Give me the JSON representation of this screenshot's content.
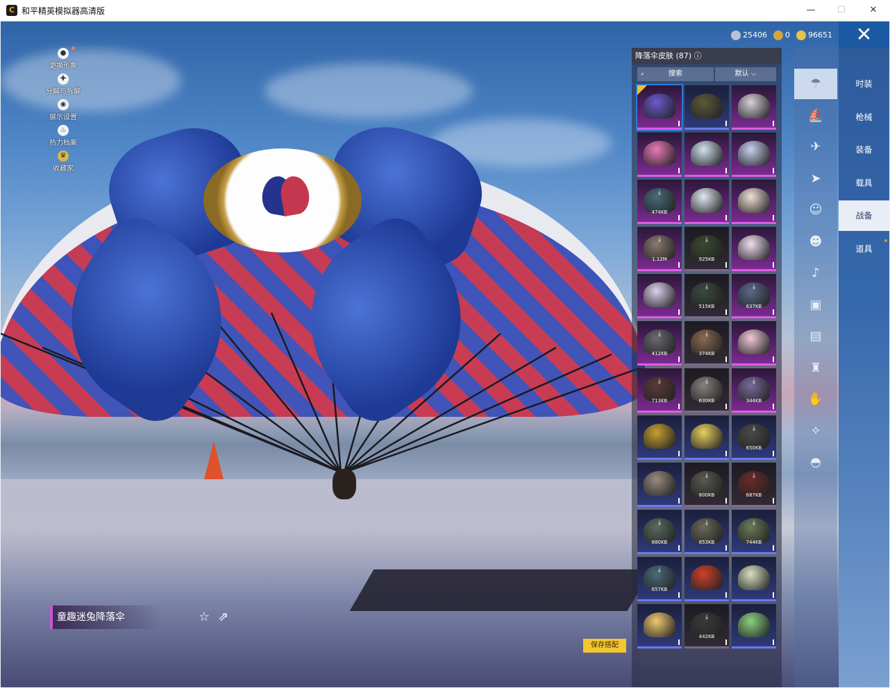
{
  "window": {
    "title": "和平精英模拟器高清版",
    "app_icon_glyph": "C",
    "controls": {
      "minimize": "—",
      "maximize": "☐",
      "close": "✕"
    }
  },
  "left_menu": [
    {
      "label": "更换形象",
      "icon": "person-icon",
      "glyph": "●"
    },
    {
      "label": "分解与拆解",
      "icon": "puzzle-icon",
      "glyph": "✚"
    },
    {
      "label": "展示设置",
      "icon": "eye-icon",
      "glyph": "◉"
    },
    {
      "label": "热力档案",
      "icon": "flame-icon",
      "glyph": "♨"
    },
    {
      "label": "收藏家",
      "icon": "crown-badge-icon",
      "glyph": "♛"
    }
  ],
  "currency": [
    {
      "value": "25406",
      "icon": "silver-coin-icon",
      "color": "#b9c3d3"
    },
    {
      "value": "0",
      "icon": "uc-token-icon",
      "color": "#d1a640"
    },
    {
      "value": "96651",
      "icon": "gold-coin-icon",
      "color": "#e9c34a"
    }
  ],
  "close_game_label": "✕",
  "panel": {
    "title": "降落伞皮肤 (87) ⓘ",
    "search_placeholder": "搜索",
    "sort_label": "默认 ⌵"
  },
  "tiles": [
    {
      "rarity": "purple",
      "size": "",
      "download": false,
      "selected": true,
      "color": "#6a5ad0"
    },
    {
      "rarity": "blue",
      "size": "",
      "download": false,
      "selected": false,
      "color": "#5a5a38"
    },
    {
      "rarity": "purple",
      "size": "",
      "download": false,
      "selected": false,
      "color": "#d8d0d8"
    },
    {
      "rarity": "purple",
      "size": "",
      "download": false,
      "selected": false,
      "color": "#e87ab8"
    },
    {
      "rarity": "purple",
      "size": "",
      "download": false,
      "selected": false,
      "color": "#cfe2ee"
    },
    {
      "rarity": "purple",
      "size": "",
      "download": false,
      "selected": false,
      "color": "#c8d0f0"
    },
    {
      "rarity": "purple",
      "size": "474KB",
      "download": true,
      "selected": false,
      "color": "#4a6a7a"
    },
    {
      "rarity": "purple",
      "size": "",
      "download": false,
      "selected": false,
      "color": "#e0e8f4"
    },
    {
      "rarity": "purple",
      "size": "",
      "download": false,
      "selected": false,
      "color": "#f0e0d8"
    },
    {
      "rarity": "purple",
      "size": "1.12M",
      "download": true,
      "selected": false,
      "color": "#8a7a70"
    },
    {
      "rarity": "dark",
      "size": "925KB",
      "download": true,
      "selected": false,
      "color": "#3a4a30"
    },
    {
      "rarity": "purple",
      "size": "",
      "download": false,
      "selected": false,
      "color": "#f0e0f0"
    },
    {
      "rarity": "purple",
      "size": "",
      "download": false,
      "selected": false,
      "color": "#dcd0ec"
    },
    {
      "rarity": "dark",
      "size": "515KB",
      "download": true,
      "selected": false,
      "color": "#3a4a40"
    },
    {
      "rarity": "purple",
      "size": "637KB",
      "download": true,
      "selected": false,
      "color": "#5a6a8a"
    },
    {
      "rarity": "purple",
      "size": "412KB",
      "download": true,
      "selected": false,
      "color": "#6a6a70"
    },
    {
      "rarity": "dark",
      "size": "374KB",
      "download": true,
      "selected": false,
      "color": "#8a6a50"
    },
    {
      "rarity": "purple",
      "size": "",
      "download": false,
      "selected": false,
      "color": "#f2c8d8"
    },
    {
      "rarity": "purple",
      "size": "713KB",
      "download": true,
      "selected": false,
      "color": "#5a3a3a"
    },
    {
      "rarity": "dark",
      "size": "630KB",
      "download": true,
      "selected": false,
      "color": "#8a8080"
    },
    {
      "rarity": "purple",
      "size": "344KB",
      "download": true,
      "selected": false,
      "color": "#7a6a9a"
    },
    {
      "rarity": "blue",
      "size": "",
      "download": false,
      "selected": false,
      "color": "#c8a030"
    },
    {
      "rarity": "blue",
      "size": "",
      "download": false,
      "selected": false,
      "color": "#e8d060"
    },
    {
      "rarity": "blue",
      "size": "650KB",
      "download": true,
      "selected": false,
      "color": "#4a4a4a"
    },
    {
      "rarity": "blue",
      "size": "",
      "download": false,
      "selected": false,
      "color": "#9a8a80"
    },
    {
      "rarity": "dark",
      "size": "800KB",
      "download": true,
      "selected": false,
      "color": "#5a5a50"
    },
    {
      "rarity": "dark",
      "size": "687KB",
      "download": true,
      "selected": false,
      "color": "#6a2a2a"
    },
    {
      "rarity": "blue",
      "size": "880KB",
      "download": true,
      "selected": false,
      "color": "#5a6a60"
    },
    {
      "rarity": "blue",
      "size": "853KB",
      "download": true,
      "selected": false,
      "color": "#6a6a5a"
    },
    {
      "rarity": "blue",
      "size": "744KB",
      "download": true,
      "selected": false,
      "color": "#6a7a5a"
    },
    {
      "rarity": "blue",
      "size": "657KB",
      "download": true,
      "selected": false,
      "color": "#4a6a7a"
    },
    {
      "rarity": "blue",
      "size": "",
      "download": false,
      "selected": false,
      "color": "#d0402a"
    },
    {
      "rarity": "blue",
      "size": "",
      "download": false,
      "selected": false,
      "color": "#d8e0c0"
    },
    {
      "rarity": "blue",
      "size": "",
      "download": false,
      "selected": false,
      "color": "#f0c870"
    },
    {
      "rarity": "dark",
      "size": "442KB",
      "download": true,
      "selected": false,
      "color": "#3a3a3a"
    },
    {
      "rarity": "blue",
      "size": "",
      "download": false,
      "selected": false,
      "color": "#8ad080"
    }
  ],
  "icon_column": [
    {
      "icon": "parachute-icon",
      "glyph": "☂",
      "active": true
    },
    {
      "icon": "bag-icon",
      "glyph": "⛵",
      "active": false
    },
    {
      "icon": "plane-icon",
      "glyph": "✈",
      "active": false
    },
    {
      "icon": "glider-icon",
      "glyph": "➤",
      "active": false
    },
    {
      "icon": "face-icon",
      "glyph": "☺",
      "active": false
    },
    {
      "icon": "robot-icon",
      "glyph": "☻",
      "active": false
    },
    {
      "icon": "speaker-icon",
      "glyph": "♪",
      "active": false
    },
    {
      "icon": "pet-icon",
      "glyph": "▣",
      "active": false
    },
    {
      "icon": "photo-icon",
      "glyph": "▤",
      "active": false
    },
    {
      "icon": "extinguisher-icon",
      "glyph": "♜",
      "active": false
    },
    {
      "icon": "hand-icon",
      "glyph": "✋",
      "active": false
    },
    {
      "icon": "wand-icon",
      "glyph": "✧",
      "active": false
    },
    {
      "icon": "ufo-icon",
      "glyph": "◓",
      "active": false
    }
  ],
  "categories": [
    {
      "label": "时装",
      "active": false,
      "dot": false
    },
    {
      "label": "枪械",
      "active": false,
      "dot": false
    },
    {
      "label": "装备",
      "active": false,
      "dot": false
    },
    {
      "label": "载具",
      "active": false,
      "dot": false
    },
    {
      "label": "战备",
      "active": true,
      "dot": false
    },
    {
      "label": "道具",
      "active": false,
      "dot": true
    }
  ],
  "item_name": "童趣迷兔降落伞",
  "favorite_glyph": "☆",
  "share_glyph": "⇗",
  "save_button": "保存搭配"
}
